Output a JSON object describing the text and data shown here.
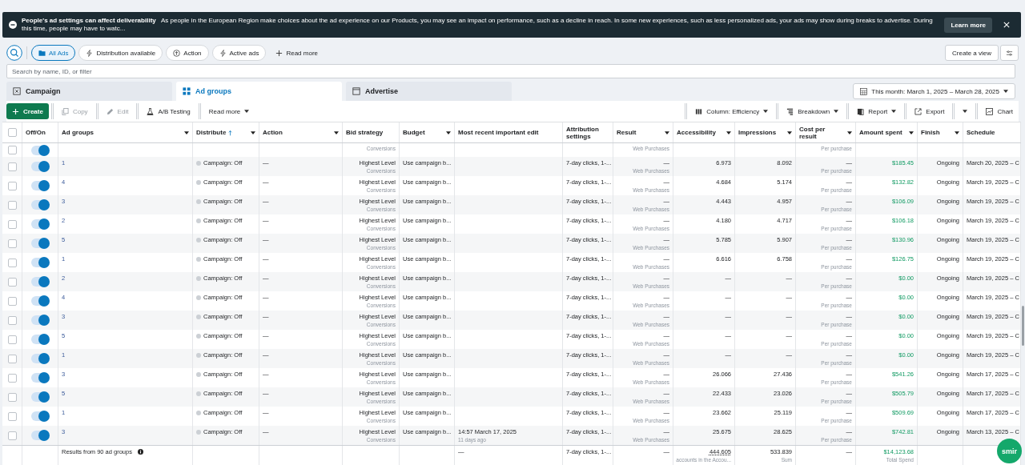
{
  "banner": {
    "title": "People's ad settings can affect deliverability",
    "message": "As people in the European Region make choices about the ad experience on our Products, you may see an impact on performance, such as a decline in reach. In some new experiences, such as less personalized ads, your ads may show during breaks to advertise. During this time, people may have to watc...",
    "button": "Learn more"
  },
  "filters": [
    {
      "label": "All Ads",
      "kind": "folder",
      "selected": true
    },
    {
      "label": "Distribution available",
      "kind": "bolt",
      "selected": false
    },
    {
      "label": "Action",
      "kind": "arrow",
      "selected": false
    },
    {
      "label": "Active ads",
      "kind": "bolt",
      "selected": false
    },
    {
      "label": "Read more",
      "kind": "plus",
      "selected": false
    }
  ],
  "create_view": "Create a view",
  "search": {
    "placeholder": "Search by name, ID, or filter"
  },
  "tabs": [
    {
      "label": "Campaign",
      "selected": false
    },
    {
      "label": "Ad groups",
      "selected": true
    },
    {
      "label": "Advertise",
      "selected": false
    }
  ],
  "date_range": "This month: March 1, 2025 – March 28, 2025",
  "toolbar_left": [
    {
      "label": "Create",
      "kind": "create",
      "disabled": false
    },
    {
      "label": "Copy",
      "kind": "copy",
      "disabled": true
    },
    {
      "label": "Edit",
      "kind": "edit",
      "disabled": true
    },
    {
      "label": "A/B Testing",
      "kind": "flask",
      "disabled": false
    },
    {
      "label": "Read more",
      "kind": "menu",
      "disabled": false
    }
  ],
  "toolbar_right": [
    {
      "label": "Column: Efficiency",
      "kind": "columns"
    },
    {
      "label": "Breakdown",
      "kind": "breakdown"
    },
    {
      "label": "Report",
      "kind": "report"
    },
    {
      "label": "Export",
      "kind": "export"
    },
    {
      "kind": "caret"
    },
    {
      "label": "Chart",
      "kind": "chart"
    }
  ],
  "table": {
    "select_all_checked": false,
    "columns": [
      {
        "label": "Off/On",
        "menu": false,
        "sorted": false
      },
      {
        "label": "Ad groups",
        "menu": true,
        "sorted": false
      },
      {
        "label": "Distribute",
        "menu": true,
        "sorted": true
      },
      {
        "label": "Action",
        "menu": true,
        "sorted": false
      },
      {
        "label": "Bid strategy",
        "menu": false,
        "sorted": false
      },
      {
        "label": "Budget",
        "menu": true,
        "sorted": false
      },
      {
        "label": "Most recent important edit",
        "menu": false,
        "sorted": false
      },
      {
        "label": "Attribution settings",
        "menu": false,
        "sorted": false
      },
      {
        "label": "Result",
        "menu": true,
        "sorted": false
      },
      {
        "label": "Accessibility",
        "menu": true,
        "sorted": false
      },
      {
        "label": "Impressions",
        "menu": true,
        "sorted": false
      },
      {
        "label": "Cost per result",
        "menu": true,
        "sorted": false
      },
      {
        "label": "Amount spent",
        "menu": true,
        "sorted": false
      },
      {
        "label": "Finish",
        "menu": true,
        "sorted": false
      },
      {
        "label": "Schedule",
        "menu": false,
        "sorted": false
      }
    ],
    "rows": [
      {
        "kind": "partial",
        "checked": false,
        "on": true,
        "bid_note": "Conversions",
        "result_note": "Web Purchases",
        "cost_note": "Per purchase"
      },
      {
        "kind": "full",
        "checked": false,
        "on": true,
        "name": "1",
        "distribution": "Campaign: Off",
        "action": "—",
        "bid": "Highest Level",
        "bid_note": "Conversions",
        "budget": "Use campaign b...",
        "attribution": "7-day clicks, 1-...",
        "result": "—",
        "result_note": "Web Purchases",
        "reach": "6.973",
        "impressions": "8.092",
        "cost": "—",
        "cost_note": "Per purchase",
        "spent": "$185.45",
        "finish": "Ongoing",
        "schedule": "March 20, 2025 – C"
      },
      {
        "kind": "full",
        "checked": false,
        "on": true,
        "name": "4",
        "distribution": "Campaign: Off",
        "action": "—",
        "bid": "Highest Level",
        "bid_note": "Conversions",
        "budget": "Use campaign b...",
        "attribution": "7-day clicks, 1-...",
        "result": "—",
        "result_note": "Web Purchases",
        "reach": "4.684",
        "impressions": "5.174",
        "cost": "—",
        "cost_note": "Per purchase",
        "spent": "$132.82",
        "finish": "Ongoing",
        "schedule": "March 19, 2025 – C"
      },
      {
        "kind": "full",
        "checked": false,
        "on": true,
        "name": "3",
        "distribution": "Campaign: Off",
        "action": "—",
        "bid": "Highest Level",
        "bid_note": "Conversions",
        "budget": "Use campaign b...",
        "attribution": "7-day clicks, 1-...",
        "result": "—",
        "result_note": "Web Purchases",
        "reach": "4.443",
        "impressions": "4.957",
        "cost": "—",
        "cost_note": "Per purchase",
        "spent": "$106.09",
        "finish": "Ongoing",
        "schedule": "March 19, 2025 – C"
      },
      {
        "kind": "full",
        "checked": false,
        "on": true,
        "name": "2",
        "distribution": "Campaign: Off",
        "action": "—",
        "bid": "Highest Level",
        "bid_note": "Conversions",
        "budget": "Use campaign b...",
        "attribution": "7-day clicks, 1-...",
        "result": "—",
        "result_note": "Web Purchases",
        "reach": "4.180",
        "impressions": "4.717",
        "cost": "—",
        "cost_note": "Per purchase",
        "spent": "$106.18",
        "finish": "Ongoing",
        "schedule": "March 19, 2025 – C"
      },
      {
        "kind": "full",
        "checked": false,
        "on": true,
        "name": "5",
        "distribution": "Campaign: Off",
        "action": "—",
        "bid": "Highest Level",
        "bid_note": "Conversions",
        "budget": "Use campaign b...",
        "attribution": "7-day clicks, 1-...",
        "result": "—",
        "result_note": "Web Purchases",
        "reach": "5.785",
        "impressions": "5.907",
        "cost": "—",
        "cost_note": "Per purchase",
        "spent": "$130.96",
        "finish": "Ongoing",
        "schedule": "March 19, 2025 – C"
      },
      {
        "kind": "full",
        "checked": false,
        "on": true,
        "name": "1",
        "distribution": "Campaign: Off",
        "action": "—",
        "bid": "Highest Level",
        "bid_note": "Conversions",
        "budget": "Use campaign b...",
        "attribution": "7-day clicks, 1-...",
        "result": "—",
        "result_note": "Web Purchases",
        "reach": "6.616",
        "impressions": "6.758",
        "cost": "—",
        "cost_note": "Per purchase",
        "spent": "$126.75",
        "finish": "Ongoing",
        "schedule": "March 19, 2025 – C"
      },
      {
        "kind": "full",
        "checked": false,
        "on": true,
        "name": "2",
        "distribution": "Campaign: Off",
        "action": "—",
        "bid": "Highest Level",
        "bid_note": "Conversions",
        "budget": "Use campaign b...",
        "attribution": "7-day clicks, 1-...",
        "result": "—",
        "result_note": "Web Purchases",
        "reach": "—",
        "impressions": "—",
        "cost": "—",
        "cost_note": "Per purchase",
        "spent": "$0.00",
        "finish": "Ongoing",
        "schedule": "March 19, 2025 – C"
      },
      {
        "kind": "full",
        "checked": false,
        "on": true,
        "name": "4",
        "distribution": "Campaign: Off",
        "action": "—",
        "bid": "Highest Level",
        "bid_note": "Conversions",
        "budget": "Use campaign b...",
        "attribution": "7-day clicks, 1-...",
        "result": "—",
        "result_note": "Web Purchases",
        "reach": "—",
        "impressions": "—",
        "cost": "—",
        "cost_note": "Per purchase",
        "spent": "$0.00",
        "finish": "Ongoing",
        "schedule": "March 19, 2025 – C"
      },
      {
        "kind": "full",
        "checked": false,
        "on": true,
        "name": "3",
        "distribution": "Campaign: Off",
        "action": "—",
        "bid": "Highest Level",
        "bid_note": "Conversions",
        "budget": "Use campaign b...",
        "attribution": "7-day clicks, 1-...",
        "result": "—",
        "result_note": "Web Purchases",
        "reach": "—",
        "impressions": "—",
        "cost": "—",
        "cost_note": "Per purchase",
        "spent": "$0.00",
        "finish": "Ongoing",
        "schedule": "March 19, 2025 – C"
      },
      {
        "kind": "full",
        "checked": false,
        "on": true,
        "name": "5",
        "distribution": "Campaign: Off",
        "action": "—",
        "bid": "Highest Level",
        "bid_note": "Conversions",
        "budget": "Use campaign b...",
        "attribution": "7-day clicks, 1-...",
        "result": "—",
        "result_note": "Web Purchases",
        "reach": "—",
        "impressions": "—",
        "cost": "—",
        "cost_note": "Per purchase",
        "spent": "$0.00",
        "finish": "Ongoing",
        "schedule": "March 19, 2025 – C"
      },
      {
        "kind": "full",
        "checked": false,
        "on": true,
        "name": "1",
        "distribution": "Campaign: Off",
        "action": "—",
        "bid": "Highest Level",
        "bid_note": "Conversions",
        "budget": "Use campaign b...",
        "attribution": "7-day clicks, 1-...",
        "result": "—",
        "result_note": "Web Purchases",
        "reach": "—",
        "impressions": "—",
        "cost": "—",
        "cost_note": "Per purchase",
        "spent": "$0.00",
        "finish": "Ongoing",
        "schedule": "March 19, 2025 – C"
      },
      {
        "kind": "full",
        "checked": false,
        "on": true,
        "name": "3",
        "distribution": "Campaign: Off",
        "action": "—",
        "bid": "Highest Level",
        "bid_note": "Conversions",
        "budget": "Use campaign b...",
        "attribution": "7-day clicks, 1-...",
        "result": "—",
        "result_note": "Web Purchases",
        "reach": "26.066",
        "impressions": "27.436",
        "cost": "—",
        "cost_note": "Per purchase",
        "spent": "$541.26",
        "finish": "Ongoing",
        "schedule": "March 17, 2025 – C"
      },
      {
        "kind": "full",
        "checked": false,
        "on": true,
        "name": "5",
        "distribution": "Campaign: Off",
        "action": "—",
        "bid": "Highest Level",
        "bid_note": "Conversions",
        "budget": "Use campaign b...",
        "attribution": "7-day clicks, 1-...",
        "result": "—",
        "result_note": "Web Purchases",
        "reach": "22.433",
        "impressions": "23.026",
        "cost": "—",
        "cost_note": "Per purchase",
        "spent": "$505.79",
        "finish": "Ongoing",
        "schedule": "March 17, 2025 – C"
      },
      {
        "kind": "full",
        "checked": false,
        "on": true,
        "name": "1",
        "distribution": "Campaign: Off",
        "action": "—",
        "bid": "Highest Level",
        "bid_note": "Conversions",
        "budget": "Use campaign b...",
        "attribution": "7-day clicks, 1-...",
        "result": "—",
        "result_note": "Web Purchases",
        "reach": "23.662",
        "impressions": "25.119",
        "cost": "—",
        "cost_note": "Per purchase",
        "spent": "$509.69",
        "finish": "Ongoing",
        "schedule": "March 17, 2025 – C"
      },
      {
        "kind": "full",
        "checked": false,
        "on": true,
        "name": "3",
        "distribution": "Campaign: Off",
        "action": "—",
        "bid": "Highest Level",
        "bid_note": "Conversions",
        "budget": "Use campaign b...",
        "edit": "14:57 March 17, 2025",
        "edit_note": "11 days ago",
        "attribution": "7-day clicks, 1-...",
        "result": "—",
        "result_note": "Web Purchases",
        "reach": "25.675",
        "impressions": "28.625",
        "cost": "—",
        "cost_note": "Per purchase",
        "spent": "$742.81",
        "finish": "Ongoing",
        "schedule": "March 13, 2025 – C"
      }
    ],
    "summary": {
      "label": "Results from 90 ad groups",
      "edit": "—",
      "attribution": "7-day clicks, 1-...",
      "result": "—",
      "reach": "444.605",
      "reach_note": "accounts in the Accou...",
      "impressions": "533.839",
      "impressions_note": "Sum",
      "cost": "—",
      "spent": "$14,123.68",
      "spent_note": "Total Spend"
    }
  },
  "assistant_button": "smir"
}
